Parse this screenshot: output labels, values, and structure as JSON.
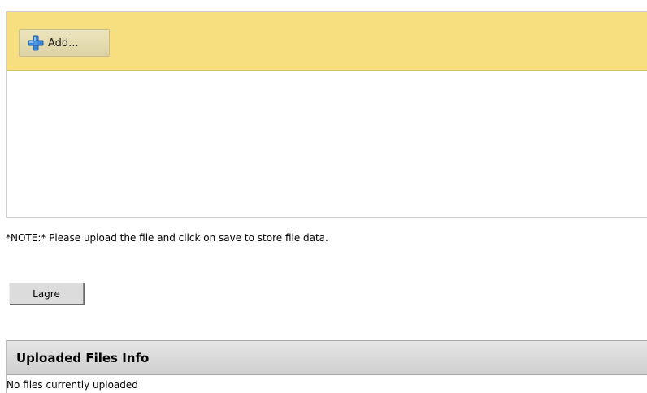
{
  "upload": {
    "add_label": "Add...",
    "add_icon": "plus-icon",
    "toolbar_color": "#f7df7f",
    "icon_color": "#3a86d4"
  },
  "note": {
    "text": "*NOTE:* Please upload the file and click on save to store file data."
  },
  "form": {
    "save_label": "Lagre"
  },
  "uploaded_files": {
    "title": "Uploaded Files Info",
    "empty_text": "No files currently uploaded"
  }
}
